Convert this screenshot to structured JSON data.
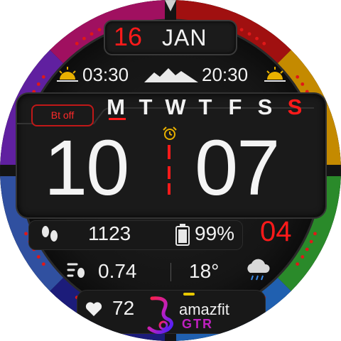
{
  "date": {
    "day": "16",
    "month": "JAN"
  },
  "sun": {
    "sunrise": "03:30",
    "sunset": "20:30",
    "sunrise_icon": "sunrise-icon",
    "mountain_icon": "mountain-icon",
    "sunset_icon": "sunset-icon"
  },
  "bluetooth": {
    "label": "Bt off"
  },
  "weekdays": [
    "M",
    "T",
    "W",
    "T",
    "F",
    "S",
    "S"
  ],
  "weekday_active_index": 0,
  "time": {
    "hours": "10",
    "minutes": "07",
    "alarm_icon": "alarm-icon"
  },
  "steps": {
    "icon": "footsteps-icon",
    "value": "1123"
  },
  "battery": {
    "icon": "battery-icon",
    "value": "99%"
  },
  "week_number": "04",
  "distance": {
    "icon": "distance-icon",
    "value": "0.74"
  },
  "weather": {
    "temperature": "18°",
    "icon": "cloud-rain-icon"
  },
  "heart": {
    "icon": "heart-icon",
    "value": "72"
  },
  "brand": {
    "name": "amazfit",
    "model": "GTR"
  },
  "colors": {
    "accent_red": "#ff1a1a",
    "text": "#f2f2f2",
    "background": "#141414"
  }
}
